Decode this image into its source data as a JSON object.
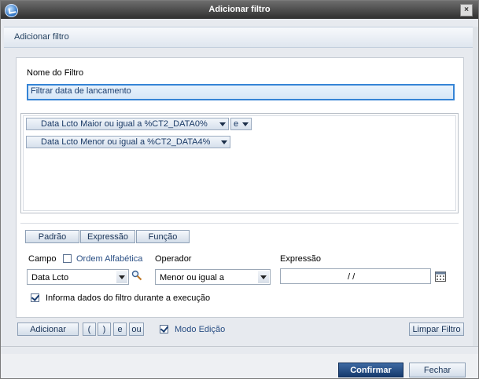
{
  "window": {
    "title": "Adicionar filtro"
  },
  "header": {
    "subtitle": "Adicionar filtro"
  },
  "name_field": {
    "label": "Nome do Filtro",
    "value": "Filtrar data de lancamento"
  },
  "conditions": [
    {
      "text": "Data Lcto Maior ou igual a %CT2_DATA0%",
      "connector": "e"
    },
    {
      "text": "Data Lcto Menor ou igual a %CT2_DATA4%"
    }
  ],
  "mode_tabs": [
    "Padrão",
    "Expressão",
    "Função"
  ],
  "field": {
    "label": "Campo",
    "alpha_label": "Ordem Alfabética",
    "alpha_checked": false,
    "value": "Data Lcto",
    "search_icon": "search-icon"
  },
  "operator": {
    "label": "Operador",
    "value": "Menor ou igual a"
  },
  "expression": {
    "label": "Expressão",
    "value": "/ /",
    "calendar_icon": "calendar-icon"
  },
  "runtime": {
    "label": "Informa dados do filtro durante a execução",
    "checked": true
  },
  "actions": {
    "add": "Adicionar",
    "open_paren": "(",
    "close_paren": ")",
    "and": "e",
    "or": "ou",
    "edit_mode": "Modo Edição",
    "edit_mode_checked": true,
    "clear": "Limpar Filtro"
  },
  "footer": {
    "confirm": "Confirmar",
    "close": "Fechar"
  }
}
